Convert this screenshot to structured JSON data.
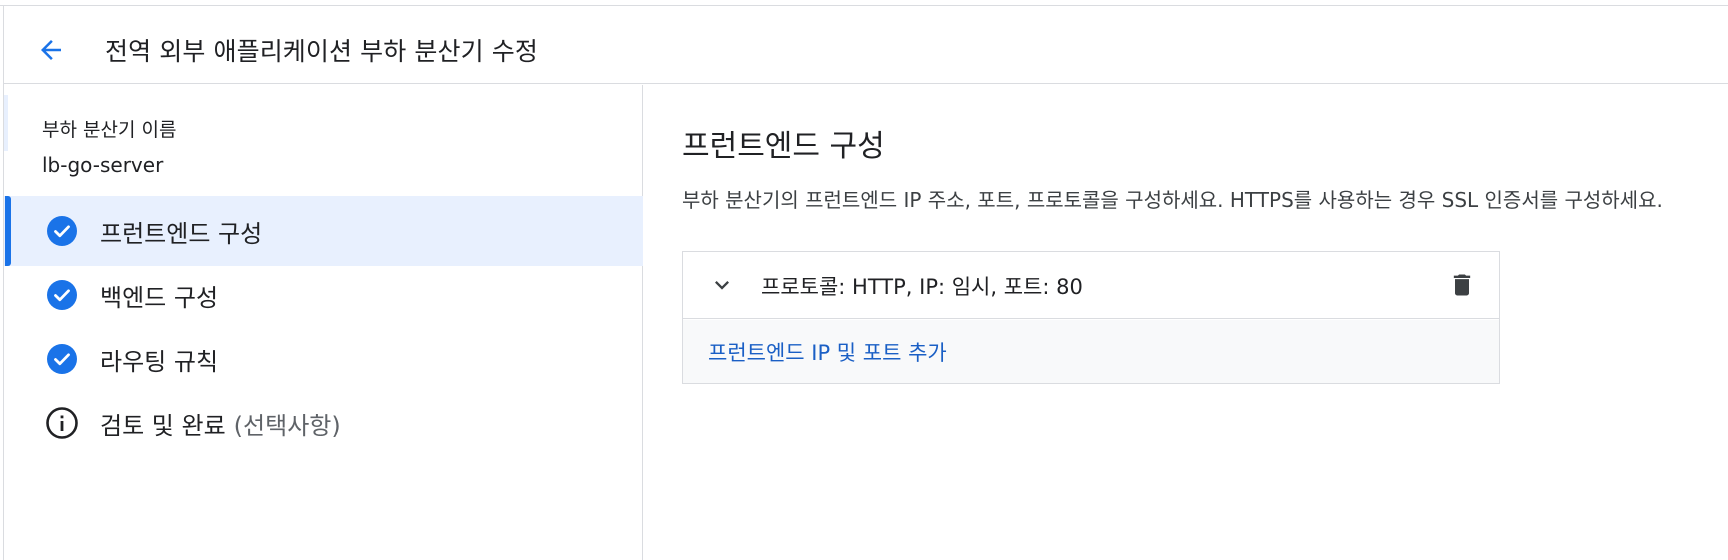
{
  "header": {
    "back_icon": "arrow-back-icon",
    "title": "전역 외부 애플리케이션 부하 분산기 수정"
  },
  "sidebar": {
    "lb_name_label": "부하 분산기 이름",
    "lb_name_value": "lb-go-server",
    "steps": [
      {
        "label": "프런트엔드 구성",
        "optional": "",
        "icon": "check-circle-icon",
        "status": "complete",
        "active": true
      },
      {
        "label": "백엔드 구성",
        "optional": "",
        "icon": "check-circle-icon",
        "status": "complete",
        "active": false
      },
      {
        "label": "라우팅 규칙",
        "optional": "",
        "icon": "check-circle-icon",
        "status": "complete",
        "active": false
      },
      {
        "label": "검토 및 완료",
        "optional": "(선택사항)",
        "icon": "info-icon",
        "status": "info",
        "active": false
      }
    ]
  },
  "main": {
    "title": "프런트엔드 구성",
    "description": "부하 분산기의 프런트엔드 IP 주소, 포트, 프로토콜을 구성하세요. HTTPS를 사용하는 경우 SSL 인증서를 구성하세요.",
    "frontends": [
      {
        "summary": "프로토콜: HTTP, IP: 임시, 포트: 80",
        "expand_icon": "chevron-down-icon",
        "delete_icon": "trash-icon"
      }
    ],
    "add_label": "프런트엔드 IP 및 포트 추가"
  },
  "colors": {
    "accent": "#1a73e8",
    "active_bg": "#e8f0fe",
    "link": "#1a5fc5",
    "border": "#dadce0"
  }
}
